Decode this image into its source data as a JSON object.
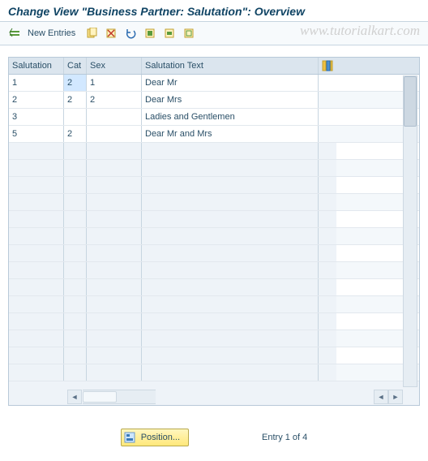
{
  "header": {
    "title": "Change View \"Business Partner: Salutation\": Overview"
  },
  "toolbar": {
    "new_entries": "New Entries"
  },
  "watermark": "www.tutorialkart.com",
  "table": {
    "columns": [
      "Salutation",
      "Cat",
      "Sex",
      "Salutation Text"
    ],
    "rows": [
      {
        "salutation": "1",
        "cat": "2",
        "sex": "1",
        "text": "Dear Mr"
      },
      {
        "salutation": "2",
        "cat": "2",
        "sex": "2",
        "text": "Dear Mrs"
      },
      {
        "salutation": "3",
        "cat": "",
        "sex": "",
        "text": "Ladies and Gentlemen"
      },
      {
        "salutation": "5",
        "cat": "2",
        "sex": "",
        "text": "Dear Mr and Mrs"
      }
    ]
  },
  "footer": {
    "position_label": "Position...",
    "entry_text": "Entry 1 of 4"
  }
}
